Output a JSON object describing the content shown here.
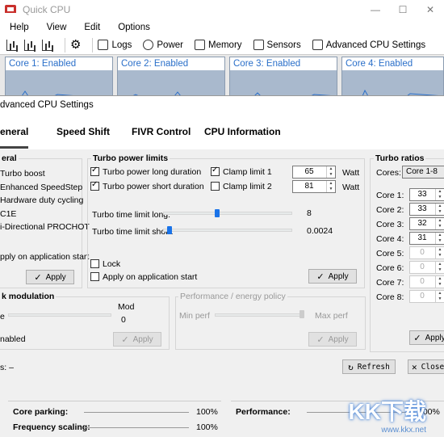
{
  "main": {
    "title": "Quick CPU",
    "window_buttons": [
      "—",
      "☐",
      "✕"
    ],
    "menu": [
      "Help",
      "View",
      "Edit",
      "Options"
    ],
    "toolbar": {
      "logs": "Logs",
      "power": "Power",
      "memory": "Memory",
      "sensors": "Sensors",
      "advanced": "Advanced CPU Settings"
    },
    "cores": [
      "Core 1: Enabled",
      "Core 2: Enabled",
      "Core 3: Enabled",
      "Core 4: Enabled"
    ]
  },
  "dialog": {
    "title": "dvanced CPU Settings",
    "tabs": [
      "eneral",
      "Speed Shift",
      "FIVR Control",
      "CPU Information"
    ],
    "general": {
      "group": "eral",
      "items": [
        "Turbo boost",
        "Enhanced SpeedStep",
        "Hardware duty cycling",
        "C1E",
        "i-Directional PROCHOT"
      ],
      "apply_on_start": "pply on application start",
      "apply": "Apply"
    },
    "turbo_power": {
      "group": "Turbo power limits",
      "long_duration": "Turbo power long duration",
      "short_duration": "Turbo power short duration",
      "clamp1": "Clamp limit 1",
      "clamp2": "Clamp limit 2",
      "value1": "65",
      "value2": "81",
      "unit": "Watt",
      "time_long_label": "Turbo time limit long:",
      "time_long_value": "8",
      "time_short_label": "Turbo time limit short:",
      "time_short_value": "0.0024",
      "lock": "Lock",
      "apply_on_start": "Apply on application start",
      "apply": "Apply",
      "slider_long_fraction": 0.4,
      "slider_short_fraction": 0.03
    },
    "turbo_ratios": {
      "group": "Turbo ratios",
      "cores_label": "Cores:",
      "cores_value": "Core 1-8",
      "rows": [
        {
          "label": "Core 1:",
          "value": "33"
        },
        {
          "label": "Core 2:",
          "value": "33"
        },
        {
          "label": "Core 3:",
          "value": "32"
        },
        {
          "label": "Core 4:",
          "value": "31"
        },
        {
          "label": "Core 5:",
          "value": "0"
        },
        {
          "label": "Core 6:",
          "value": "0"
        },
        {
          "label": "Core 7:",
          "value": "0"
        },
        {
          "label": "Core 8:",
          "value": "0"
        }
      ],
      "apply": "Apply"
    },
    "clock_mod": {
      "group": "k modulation",
      "left": "e",
      "mod_label": "Mod",
      "mod_value": "0",
      "enabled": "nabled",
      "apply": "Apply"
    },
    "perf_policy": {
      "group": "Performance / energy policy",
      "min": "Min perf",
      "max": "Max perf",
      "apply": "Apply"
    },
    "status": "s: –",
    "refresh": "Refresh",
    "close": "Close"
  },
  "bottom": {
    "core_parking": "Core parking:",
    "core_parking_value": "100%",
    "freq_scaling": "Frequency scaling:",
    "freq_scaling_value": "100%",
    "performance": "Performance:",
    "performance_value": "100%"
  },
  "watermark": {
    "text": "KK下载",
    "url": "www.kkx.net"
  }
}
